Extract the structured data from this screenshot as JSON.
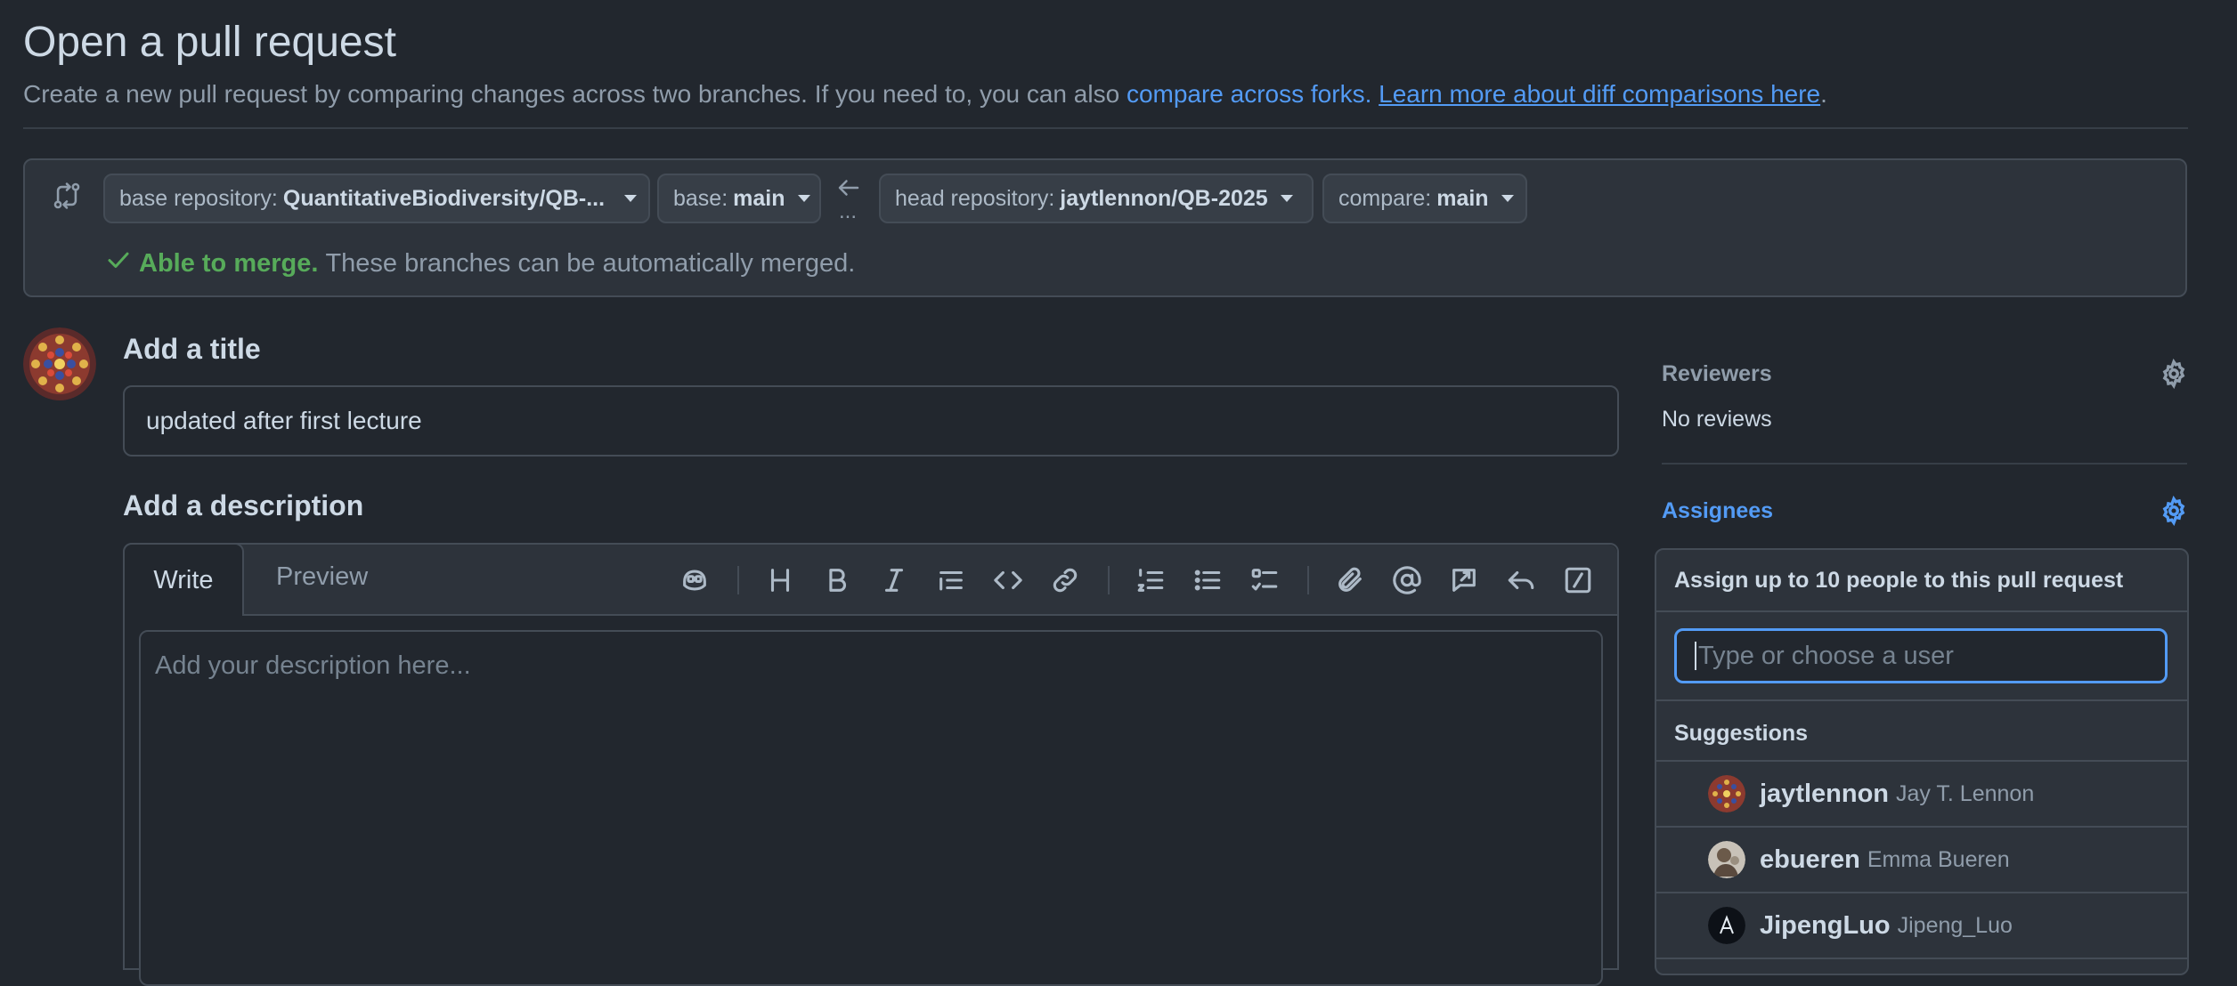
{
  "page": {
    "title": "Open a pull request",
    "subtitle_prefix": "Create a new pull request by comparing changes across two branches. If you need to, you can also ",
    "compare_forks_link": "compare across forks.",
    "learn_more_link": "Learn more about diff comparisons here",
    "subtitle_suffix": "."
  },
  "compare": {
    "base_repo_label": "base repository:",
    "base_repo_value": "QuantitativeBiodiversity/QB-...",
    "base_label": "base:",
    "base_value": "main",
    "head_repo_label": "head repository:",
    "head_repo_value": "jaytlennon/QB-2025",
    "compare_label": "compare:",
    "compare_value": "main",
    "swap_dots": "...",
    "merge_status": "Able to merge.",
    "merge_detail": "These branches can be automatically merged."
  },
  "form": {
    "title_heading": "Add a title",
    "title_value": "updated after first lecture",
    "desc_heading": "Add a description",
    "tab_write": "Write",
    "tab_preview": "Preview",
    "desc_placeholder": "Add your description here...",
    "toolbar_icons": [
      "copilot-icon",
      "heading-icon",
      "bold-icon",
      "italic-icon",
      "quote-icon",
      "code-icon",
      "link-icon",
      "ordered-list-icon",
      "unordered-list-icon",
      "task-list-icon",
      "attach-icon",
      "mention-icon",
      "reference-icon",
      "reply-icon",
      "slash-command-icon"
    ]
  },
  "sidebar": {
    "reviewers_label": "Reviewers",
    "reviewers_value": "No reviews",
    "assignees_label": "Assignees",
    "accent_color": "#539bf5"
  },
  "assign_popover": {
    "title": "Assign up to 10 people to this pull request",
    "input_placeholder": "Type or choose a user",
    "suggestions_label": "Suggestions",
    "users": [
      {
        "login": "jaytlennon",
        "name": "Jay T. Lennon"
      },
      {
        "login": "ebueren",
        "name": "Emma Bueren"
      },
      {
        "login": "JipengLuo",
        "name": "Jipeng_Luo"
      }
    ]
  }
}
